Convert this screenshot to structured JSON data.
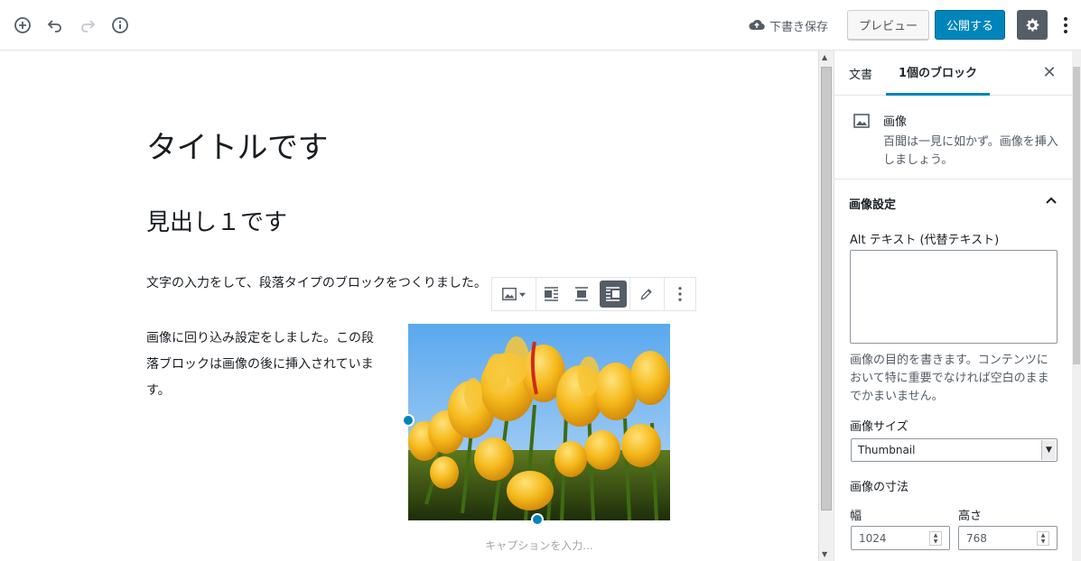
{
  "header": {
    "save_draft": "下書き保存",
    "preview": "プレビュー",
    "publish": "公開する"
  },
  "editor": {
    "title": "タイトルです",
    "heading": "見出し１です",
    "paragraph1": "文字の入力をして、段落タイプのブロックをつくりました。",
    "paragraph2": "画像に回り込み設定をしました。この段落ブロックは画像の後に挿入されています。",
    "caption_placeholder": "キャプションを入力..."
  },
  "sidebar": {
    "tabs": [
      {
        "label": "文書"
      },
      {
        "label": "1個のブロック"
      }
    ],
    "block": {
      "name": "画像",
      "description": "百聞は一見に如かず。画像を挿入しましょう。"
    },
    "panel": {
      "title": "画像設定",
      "alt_label": "Alt テキスト (代替テキスト)",
      "alt_value": "",
      "alt_help": "画像の目的を書きます。コンテンツにおいて特に重要でなければ空白のままでかまいません。",
      "size_label": "画像サイズ",
      "size_value": "Thumbnail",
      "dimensions_label": "画像の寸法",
      "width_label": "幅",
      "width_value": "1024",
      "height_label": "高さ",
      "height_value": "768"
    }
  },
  "colors": {
    "accent": "#0085ba",
    "dark": "#555d66"
  }
}
